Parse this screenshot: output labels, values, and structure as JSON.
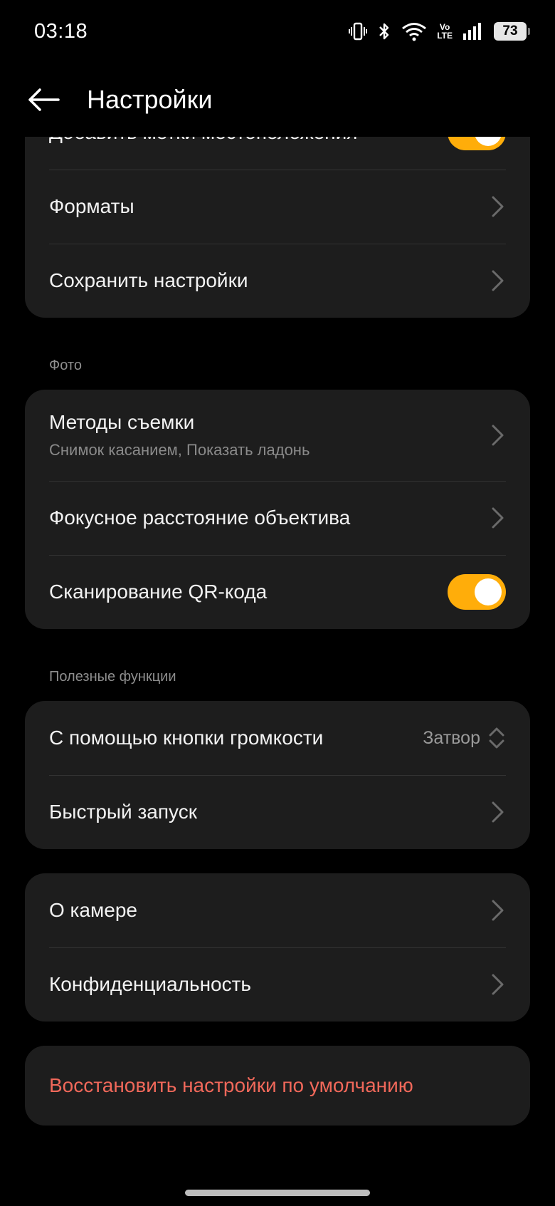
{
  "status_bar": {
    "time": "03:18",
    "volte_top": "Vo",
    "volte_bottom": "LTE",
    "battery": "73"
  },
  "header": {
    "title": "Настройки"
  },
  "colors": {
    "accent_toggle": "#ffad0a",
    "danger_text": "#f0685a",
    "card_bg": "#1d1d1d"
  },
  "general": {
    "location_tags": "Добавить метки местоположения",
    "location_tags_on": true,
    "formats": "Форматы",
    "save_settings": "Сохранить настройки"
  },
  "photo": {
    "section_title": "Фото",
    "shooting_methods": "Методы съемки",
    "shooting_methods_sub": "Снимок касанием, Показать ладонь",
    "focal_length": "Фокусное расстояние объектива",
    "qr_scan": "Сканирование QR-кода",
    "qr_scan_on": true
  },
  "useful": {
    "section_title": "Полезные функции",
    "volume_button": "С помощью кнопки громкости",
    "volume_button_value": "Затвор",
    "quick_launch": "Быстрый запуск"
  },
  "about": {
    "about_camera": "О камере",
    "privacy": "Конфиденциальность"
  },
  "reset": {
    "label": "Восстановить настройки по умолчанию"
  }
}
